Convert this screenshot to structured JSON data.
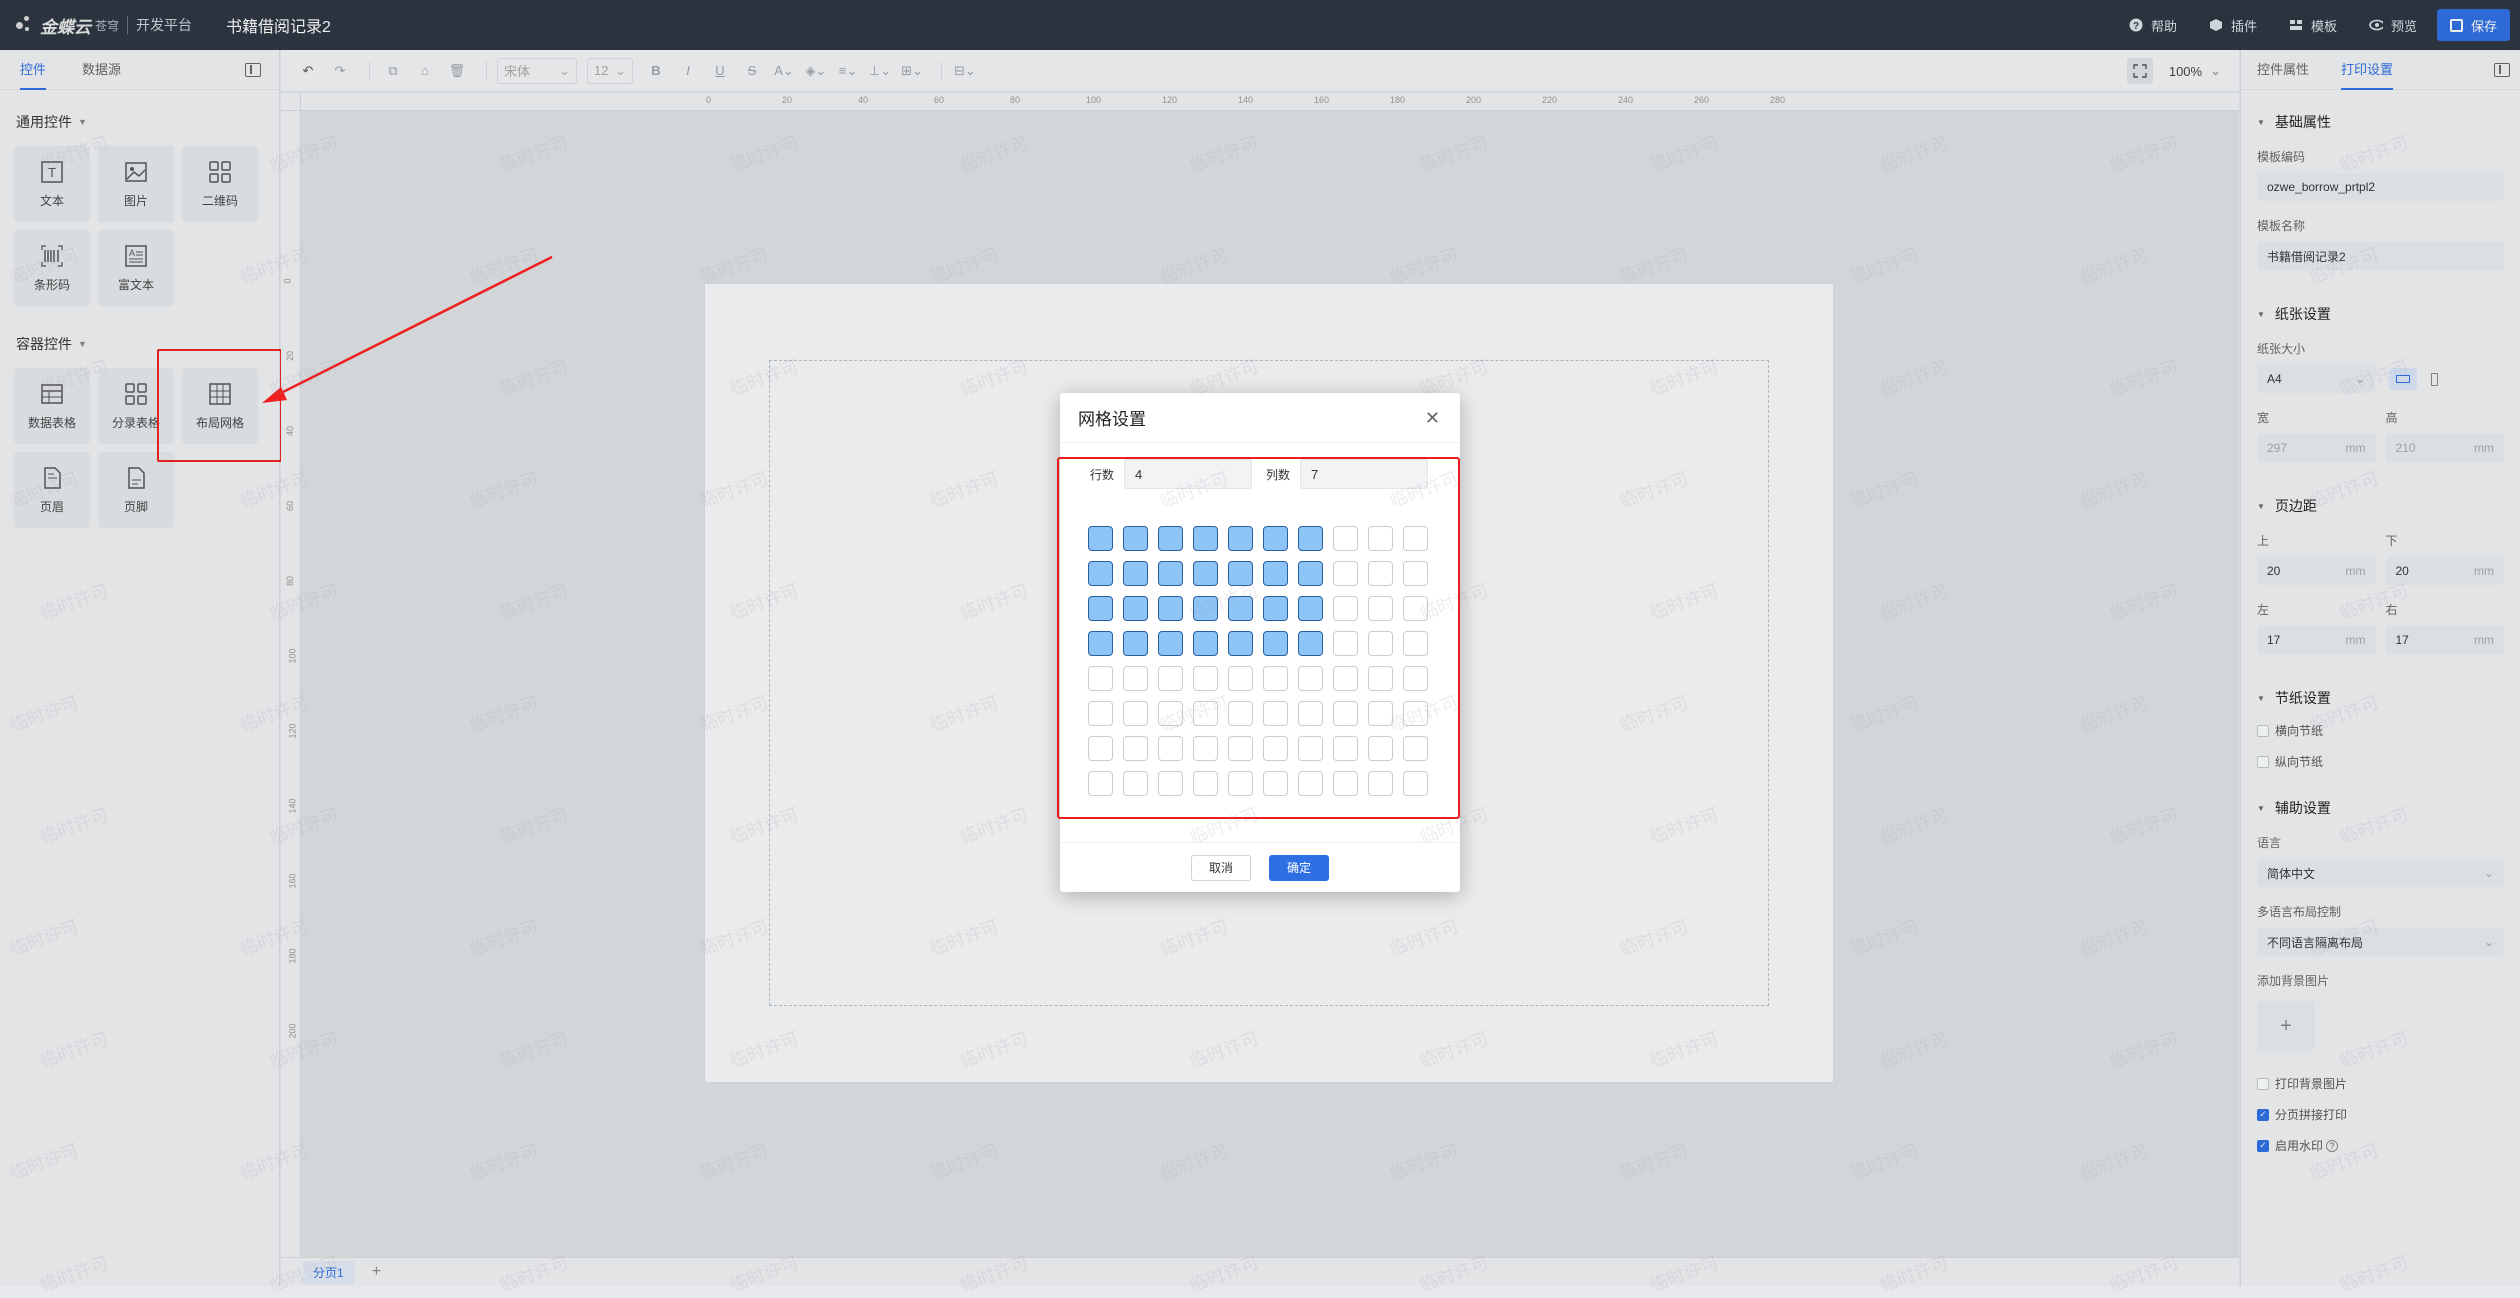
{
  "topbar": {
    "brand": "金蝶云",
    "brand_sub": "苍穹",
    "platform": "开发平台",
    "doc_title": "书籍借阅记录2",
    "actions": [
      {
        "label": "帮助",
        "icon": "help-icon"
      },
      {
        "label": "插件",
        "icon": "plugin-icon"
      },
      {
        "label": "模板",
        "icon": "template-icon"
      },
      {
        "label": "预览",
        "icon": "eye-icon"
      }
    ],
    "save_label": "保存"
  },
  "left_panel": {
    "tabs": [
      "控件",
      "数据源"
    ],
    "general_title": "通用控件",
    "general_controls": [
      {
        "label": "文本",
        "icon": "text-icon"
      },
      {
        "label": "图片",
        "icon": "image-icon"
      },
      {
        "label": "二维码",
        "icon": "qrcode-icon"
      },
      {
        "label": "条形码",
        "icon": "barcode-icon"
      },
      {
        "label": "富文本",
        "icon": "richtext-icon"
      }
    ],
    "container_title": "容器控件",
    "container_controls": [
      {
        "label": "数据表格",
        "icon": "datatable-icon"
      },
      {
        "label": "分录表格",
        "icon": "entrytable-icon"
      },
      {
        "label": "布局网格",
        "icon": "layoutgrid-icon"
      },
      {
        "label": "页眉",
        "icon": "header-icon"
      },
      {
        "label": "页脚",
        "icon": "footer-icon"
      }
    ]
  },
  "toolbar": {
    "font_family": "宋体",
    "font_size": "12",
    "zoom": "100%"
  },
  "ruler": {
    "h_labels": [
      "0",
      "20",
      "40",
      "60",
      "80",
      "100",
      "120",
      "140",
      "160",
      "180",
      "200",
      "220",
      "240",
      "260",
      "280"
    ],
    "v_labels": [
      "0",
      "20",
      "40",
      "60",
      "80",
      "100",
      "120",
      "140",
      "160",
      "180",
      "200"
    ]
  },
  "page_tabs": {
    "tab": "分页1",
    "add": "+"
  },
  "dialog": {
    "title": "网格设置",
    "rows_label": "行数",
    "rows_value": "4",
    "cols_label": "列数",
    "cols_value": "7",
    "grid_rows": 8,
    "grid_cols": 10,
    "selected_rows": 4,
    "selected_cols": 7,
    "cancel": "取消",
    "ok": "确定"
  },
  "right_panel": {
    "tabs": [
      "控件属性",
      "打印设置"
    ],
    "basic_title": "基础属性",
    "template_code_label": "模板编码",
    "template_code": "ozwe_borrow_prtpl2",
    "template_name_label": "模板名称",
    "template_name": "书籍借阅记录2",
    "paper_title": "纸张设置",
    "paper_size_label": "纸张大小",
    "paper_size": "A4",
    "width_label": "宽",
    "width_value": "297",
    "height_label": "高",
    "height_value": "210",
    "unit": "mm",
    "margin_title": "页边距",
    "top_label": "上",
    "top_value": "20",
    "bottom_label": "下",
    "bottom_value": "20",
    "left_label": "左",
    "left_value": "17",
    "right_label": "右",
    "right_value": "17",
    "section_title": "节纸设置",
    "horizontal_section": "横向节纸",
    "vertical_section": "纵向节纸",
    "aux_title": "辅助设置",
    "language_label": "语言",
    "language": "简体中文",
    "multilang_label": "多语言布局控制",
    "multilang": "不同语言隔离布局",
    "bgimg_label": "添加背景图片",
    "print_bg": "打印背景图片",
    "page_join": "分页拼接打印",
    "watermark": "启用水印"
  },
  "watermark_text": "临时许可",
  "colors": {
    "accent": "#2f6fe4",
    "highlight": "#ec1c1c",
    "cell_selected": "#8ec5f7"
  }
}
